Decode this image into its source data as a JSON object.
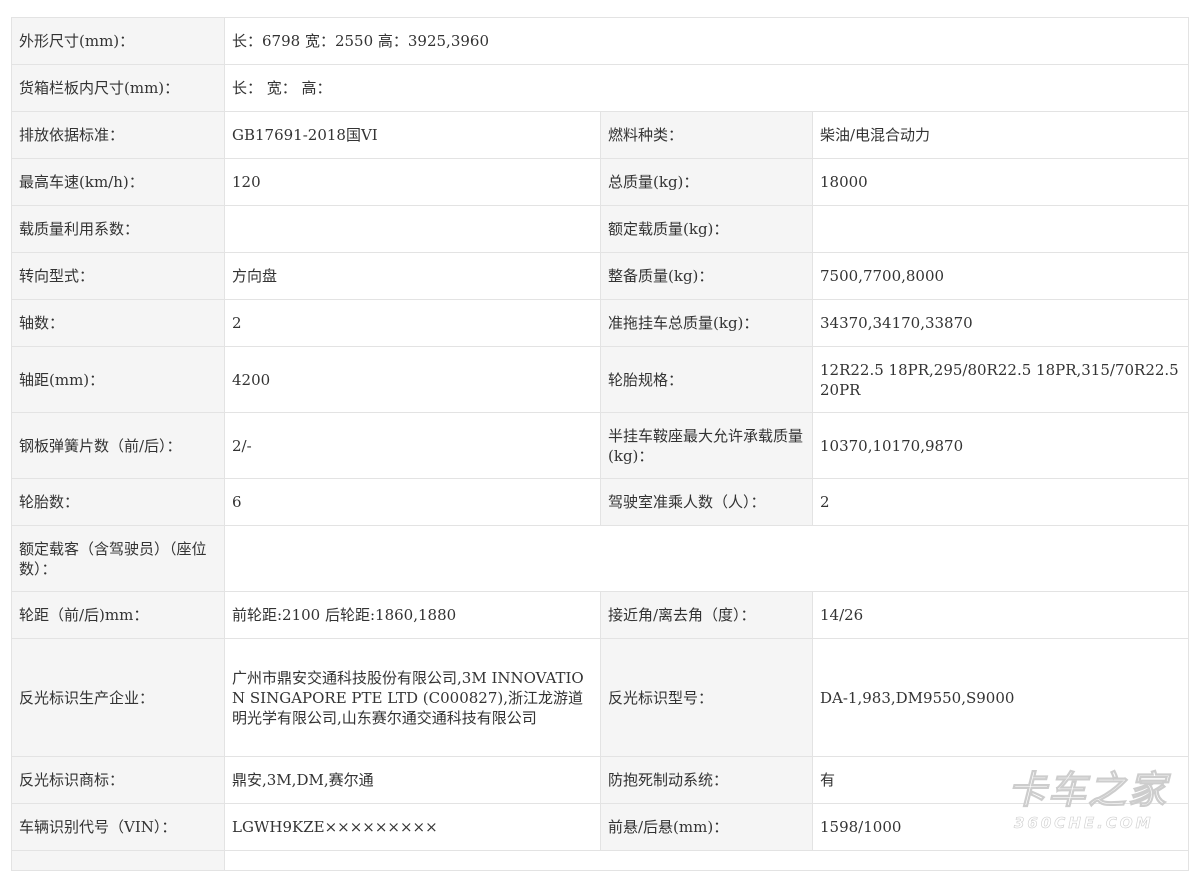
{
  "rows": [
    {
      "l1": "外形尺寸(mm)：",
      "v1": "长：6798 宽：2550 高：3925,3960"
    },
    {
      "l1": "货箱栏板内尺寸(mm)：",
      "v1": "长： 宽： 高："
    },
    {
      "l1": "排放依据标准：",
      "v1": "GB17691-2018国VI",
      "l2": "燃料种类：",
      "v2": "柴油/电混合动力"
    },
    {
      "l1": "最高车速(km/h)：",
      "v1": "120",
      "l2": "总质量(kg)：",
      "v2": "18000"
    },
    {
      "l1": "载质量利用系数：",
      "v1": "",
      "l2": "额定载质量(kg)：",
      "v2": ""
    },
    {
      "l1": "转向型式：",
      "v1": "方向盘",
      "l2": "整备质量(kg)：",
      "v2": "7500,7700,8000"
    },
    {
      "l1": "轴数：",
      "v1": "2",
      "l2": "准拖挂车总质量(kg)：",
      "v2": "34370,34170,33870"
    },
    {
      "l1": "轴距(mm)：",
      "v1": "4200",
      "l2": "轮胎规格：",
      "v2": "12R22.5 18PR,295/80R22.5 18PR,315/70R22.5 20PR"
    },
    {
      "l1": "钢板弹簧片数（前/后）：",
      "v1": "2/-",
      "l2": "半挂车鞍座最大允许承载质量(kg)：",
      "v2": "10370,10170,9870"
    },
    {
      "l1": "轮胎数：",
      "v1": "6",
      "l2": "驾驶室准乘人数（人）：",
      "v2": "2"
    },
    {
      "l1": "额定载客（含驾驶员）（座位数）：",
      "v1": ""
    },
    {
      "l1": "轮距（前/后)mm：",
      "v1": "前轮距:2100 后轮距:1860,1880",
      "l2": "接近角/离去角（度）：",
      "v2": "14/26"
    },
    {
      "l1": "反光标识生产企业：",
      "v1": "广州市鼎安交通科技股份有限公司,3M INNOVATION SINGAPORE PTE LTD (C000827),浙江龙游道明光学有限公司,山东赛尔通交通科技有限公司",
      "l2": "反光标识型号：",
      "v2": "DA-1,983,DM9550,S9000"
    },
    {
      "l1": "反光标识商标：",
      "v1": "鼎安,3M,DM,赛尔通",
      "l2": "防抱死制动系统：",
      "v2": "有"
    },
    {
      "l1": "车辆识别代号（VIN）：",
      "v1": "LGWH9KZE×××××××××",
      "l2": "前悬/后悬(mm)：",
      "v2": "1598/1000"
    },
    {
      "l1": "",
      "v1": ""
    }
  ],
  "watermark": {
    "main": "卡车之家",
    "sub": "360CHE.COM"
  }
}
